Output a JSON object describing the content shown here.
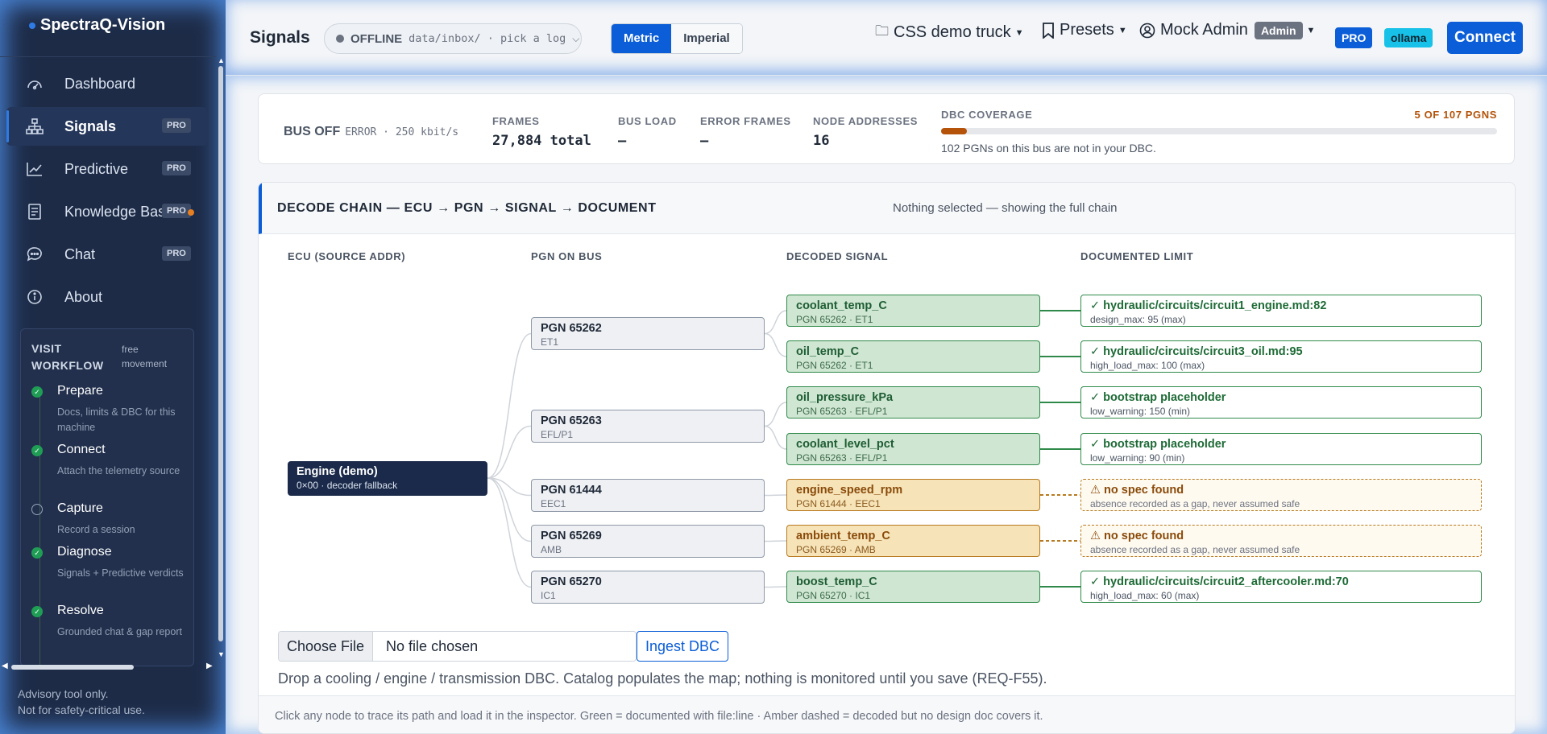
{
  "app": {
    "name": "SpectraQ-Vision"
  },
  "sidebar": {
    "items": [
      {
        "label": "Dashboard",
        "icon": "dashboard-icon",
        "pro": ""
      },
      {
        "label": "Signals",
        "icon": "network-icon",
        "pro": "PRO",
        "active": true
      },
      {
        "label": "Predictive",
        "icon": "trend-icon",
        "pro": "PRO"
      },
      {
        "label": "Knowledge Base",
        "icon": "book-icon",
        "pro": "PRO"
      },
      {
        "label": "Chat",
        "icon": "chat-icon",
        "pro": "PRO"
      },
      {
        "label": "About",
        "icon": "info-icon",
        "pro": ""
      }
    ],
    "workflow": {
      "title": "VISIT WORKFLOW",
      "subtitle": "free movement",
      "steps": [
        {
          "name": "Prepare",
          "desc": "Docs, limits & DBC for this machine",
          "done": true
        },
        {
          "name": "Connect",
          "desc": "Attach the telemetry source",
          "done": true
        },
        {
          "name": "Capture",
          "desc": "Record a session",
          "done": false
        },
        {
          "name": "Diagnose",
          "desc": "Signals + Predictive verdicts",
          "done": true
        },
        {
          "name": "Resolve",
          "desc": "Grounded chat & gap report",
          "done": true
        }
      ]
    },
    "advisory": [
      "Advisory tool only.",
      "Not for safety-critical use."
    ]
  },
  "header": {
    "title": "Signals",
    "status": "OFFLINE",
    "source_path": "data/inbox/ · pick a log",
    "units": {
      "metric": "Metric",
      "imperial": "Imperial",
      "selected": "Metric"
    },
    "vehicle": "CSS demo truck",
    "presets": "Presets",
    "user": "Mock Admin",
    "role": "Admin",
    "pro_badge": "PRO",
    "llm_badge": "ollama",
    "connect": "Connect"
  },
  "stats": {
    "bus_state": "BUS OFF",
    "bus_detail": "ERROR · 250 kbit/s",
    "frames_label": "FRAMES",
    "frames_value": "27,884 total",
    "busload_label": "BUS LOAD",
    "busload_value": "—",
    "errorframes_label": "ERROR FRAMES",
    "errorframes_value": "—",
    "nodes_label": "NODE ADDRESSES",
    "nodes_value": "16",
    "coverage_label": "DBC COVERAGE",
    "coverage_count": "5 OF 107 PGNS",
    "coverage_fraction": 0.047,
    "coverage_note": "102 PGNs on this bus are not in your DBC."
  },
  "chain": {
    "title": "DECODE CHAIN — ECU → PGN → SIGNAL → DOCUMENT",
    "selection": "Nothing selected — showing the full chain",
    "columns": [
      "ECU (SOURCE ADDR)",
      "PGN ON BUS",
      "DECODED SIGNAL",
      "DOCUMENTED LIMIT"
    ],
    "ecu": {
      "title": "Engine (demo)",
      "sub": "0×00 · decoder fallback"
    },
    "pgns": [
      {
        "title": "PGN 65262",
        "sub": "ET1"
      },
      {
        "title": "PGN 65263",
        "sub": "EFL/P1"
      },
      {
        "title": "PGN 61444",
        "sub": "EEC1"
      },
      {
        "title": "PGN 65269",
        "sub": "AMB"
      },
      {
        "title": "PGN 65270",
        "sub": "IC1"
      }
    ],
    "signals": [
      {
        "title": "coolant_temp_C",
        "sub": "PGN 65262 · ET1",
        "status": "ok"
      },
      {
        "title": "oil_temp_C",
        "sub": "PGN 65262 · ET1",
        "status": "ok"
      },
      {
        "title": "oil_pressure_kPa",
        "sub": "PGN 65263 · EFL/P1",
        "status": "ok"
      },
      {
        "title": "coolant_level_pct",
        "sub": "PGN 65263 · EFL/P1",
        "status": "ok"
      },
      {
        "title": "engine_speed_rpm",
        "sub": "PGN 61444 · EEC1",
        "status": "warn"
      },
      {
        "title": "ambient_temp_C",
        "sub": "PGN 65269 · AMB",
        "status": "warn"
      },
      {
        "title": "boost_temp_C",
        "sub": "PGN 65270 · IC1",
        "status": "ok"
      }
    ],
    "limits": [
      {
        "title": "✓ hydraulic/circuits/circuit1_engine.md:82",
        "sub": "design_max: 95 (max)",
        "status": "ok"
      },
      {
        "title": "✓ hydraulic/circuits/circuit3_oil.md:95",
        "sub": "high_load_max: 100 (max)",
        "status": "ok"
      },
      {
        "title": "✓ bootstrap placeholder",
        "sub": "low_warning: 150 (min)",
        "status": "ok"
      },
      {
        "title": "✓ bootstrap placeholder",
        "sub": "low_warning: 90 (min)",
        "status": "ok"
      },
      {
        "title": "⚠ no spec found",
        "sub": "absence recorded as a gap, never assumed safe",
        "status": "warn"
      },
      {
        "title": "⚠ no spec found",
        "sub": "absence recorded as a gap, never assumed safe",
        "status": "warn"
      },
      {
        "title": "✓ hydraulic/circuits/circuit2_aftercooler.md:70",
        "sub": "high_load_max: 60 (max)",
        "status": "ok"
      }
    ],
    "upload": {
      "choose": "Choose File",
      "nofile": "No file chosen",
      "ingest": "Ingest DBC",
      "note": "Drop a cooling / engine / transmission DBC. Catalog populates the map; nothing is monitored until you save (REQ-F55)."
    },
    "footer": "Click any node to trace its path and load it in the inspector. Green = documented with file:line · Amber dashed = decoded but no design doc covers it."
  },
  "colors": {
    "accent": "#0b5ed7",
    "ok": "#2f8a4a",
    "warn": "#b7791f",
    "sidebar": "#1d2b47"
  }
}
